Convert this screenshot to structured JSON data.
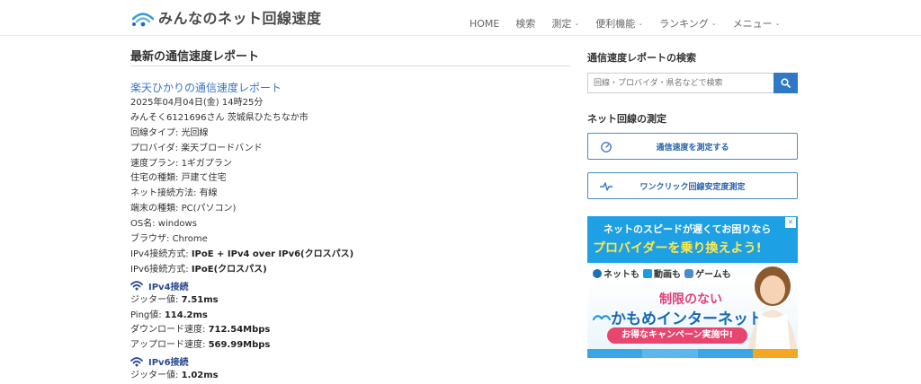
{
  "header": {
    "logo_text": "みんなのネット回線速度",
    "nav": [
      {
        "label": "HOME",
        "caret": false
      },
      {
        "label": "検索",
        "caret": false
      },
      {
        "label": "測定",
        "caret": true
      },
      {
        "label": "便利機能",
        "caret": true
      },
      {
        "label": "ランキング",
        "caret": true
      },
      {
        "label": "メニュー",
        "caret": true
      }
    ]
  },
  "main": {
    "title": "最新の通信速度レポート",
    "report_link": "楽天ひかりの通信速度レポート",
    "date": "2025年04月04日(金) 14時25分",
    "user": "みんそく6121696さん 茨城県ひたちなか市",
    "fields": [
      {
        "label": "回線タイプ:",
        "value": "光回線"
      },
      {
        "label": "プロバイダ:",
        "value": "楽天ブロードバンド"
      },
      {
        "label": "速度プラン:",
        "value": "1ギガプラン"
      },
      {
        "label": "住宅の種類:",
        "value": "戸建て住宅"
      },
      {
        "label": "ネット接続方法:",
        "value": "有線"
      },
      {
        "label": "端末の種類:",
        "value": "PC(パソコン)"
      },
      {
        "label": "OS名:",
        "value": "windows"
      },
      {
        "label": "ブラウザ:",
        "value": "Chrome"
      }
    ],
    "ipv4_method_label": "IPv4接続方式:",
    "ipv4_method_value": "IPoE + IPv4 over IPv6(クロスパス)",
    "ipv6_method_label": "IPv6接続方式:",
    "ipv6_method_value": "IPoE(クロスパス)",
    "ipv4_heading": "IPv4接続",
    "ipv4_stats": [
      {
        "label": "ジッター値:",
        "value": "7.51ms"
      },
      {
        "label": "Ping値:",
        "value": "114.2ms"
      },
      {
        "label": "ダウンロード速度:",
        "value": "712.54Mbps"
      },
      {
        "label": "アップロード速度:",
        "value": "569.99Mbps"
      }
    ],
    "ipv6_heading": "IPv6接続",
    "ipv6_stats": [
      {
        "label": "ジッター値:",
        "value": "1.02ms"
      }
    ]
  },
  "sidebar": {
    "search_heading": "通信速度レポートの検索",
    "search_placeholder": "回線・プロバイダ・県名などで検索",
    "measure_heading": "ネット回線の測定",
    "measure_button": "通信速度を測定する",
    "stability_button": "ワンクリック回線安定度測定",
    "ad": {
      "line1": "ネットのスピードが遅くてお困りなら",
      "line2": "プロバイダーを乗り換えよう!",
      "features": [
        "ネットも",
        "動画も",
        "ゲームも"
      ],
      "limit_text": "制限のない",
      "brand": "かもめインターネット",
      "campaign": "お得なキャンペーン実施中!",
      "close": "✕"
    }
  },
  "colors": {
    "accent": "#3a74c8",
    "button_blue": "#2f78c4",
    "heading_navy": "#2a4a8e",
    "ad_blue": "#1ea0e4",
    "ad_pink": "#e8456f"
  }
}
